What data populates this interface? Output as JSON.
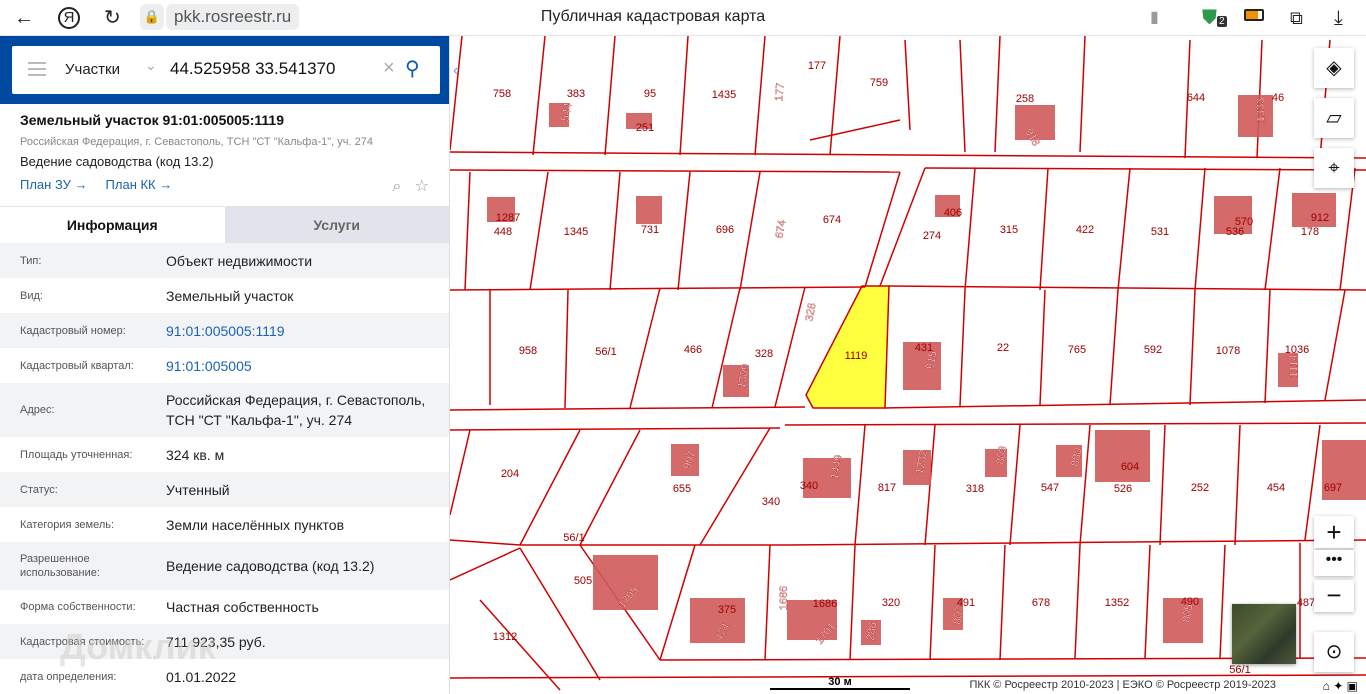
{
  "browser": {
    "url": "pkk.rosreestr.ru",
    "title": "Публичная кадастровая карта",
    "tab_badge": "2"
  },
  "search": {
    "type": "Участки",
    "query": "44.525958 33.541370"
  },
  "card": {
    "title": "Земельный участок 91:01:005005:1119",
    "address": "Российская Федерация, г. Севастополь, ТСН \"СТ \"Кальфа-1\", уч. 274",
    "use": "Ведение садоводства (код 13.2)",
    "links": [
      "План ЗУ →",
      "План КК →"
    ]
  },
  "tabs": [
    "Информация",
    "Услуги"
  ],
  "info": [
    {
      "label": "Тип:",
      "value": "Объект недвижимости"
    },
    {
      "label": "Вид:",
      "value": "Земельный участок"
    },
    {
      "label": "Кадастровый номер:",
      "value": "91:01:005005:1119"
    },
    {
      "label": "Кадастровый квартал:",
      "value": "91:01:005005"
    },
    {
      "label": "Адрес:",
      "value": "Российская Федерация, г. Севастополь, ТСН \"СТ \"Кальфа-1\", уч. 274"
    },
    {
      "label": "Площадь уточненная:",
      "value": "324 кв. м"
    },
    {
      "label": "Статус:",
      "value": "Учтенный"
    },
    {
      "label": "Категория земель:",
      "value": "Земли населённых пунктов"
    },
    {
      "label": "Разрешенное использование:",
      "value": "Ведение садоводства (код 13.2)"
    },
    {
      "label": "Форма собственности:",
      "value": "Частная собственность"
    },
    {
      "label": "Кадастровая стоимость:",
      "value": "711 923,35 руб."
    },
    {
      "label": "дата определения:",
      "value": "01.01.2022"
    }
  ],
  "watermark": "Домклик",
  "map": {
    "selected_parcel": "1119",
    "labels": [
      "758",
      "383",
      "544",
      "95",
      "251",
      "1435",
      "177",
      "177",
      "759",
      "258",
      "918",
      "644",
      "1333",
      "46",
      "1287",
      "448",
      "1345",
      "731",
      "696",
      "674",
      "674",
      "406",
      "274",
      "315",
      "422",
      "531",
      "570",
      "536",
      "912",
      "178",
      "958",
      "56/1",
      "466",
      "328",
      "1309",
      "328",
      "1119",
      "431",
      "915",
      "22",
      "765",
      "592",
      "1078",
      "1036",
      "1114",
      "204",
      "907",
      "655",
      "1449",
      "340",
      "340",
      "817",
      "1232",
      "318",
      "803",
      "880",
      "547",
      "604",
      "526",
      "252",
      "454",
      "697",
      "56/1",
      "505",
      "1705",
      "1312",
      "375",
      "474",
      "1686",
      "1686",
      "1701",
      "320",
      "286",
      "491",
      "807",
      "678",
      "1352",
      "490",
      "805",
      "487",
      "56/1"
    ],
    "scale": "30 м",
    "attribution": "ПКК © Росреестр 2010-2023 | ЕЭКО © Росреестр 2019-2023",
    "colors": {
      "border": "#d10000",
      "building": "#d05a5a",
      "selected": "#ffff40",
      "label": "#a00000"
    }
  }
}
